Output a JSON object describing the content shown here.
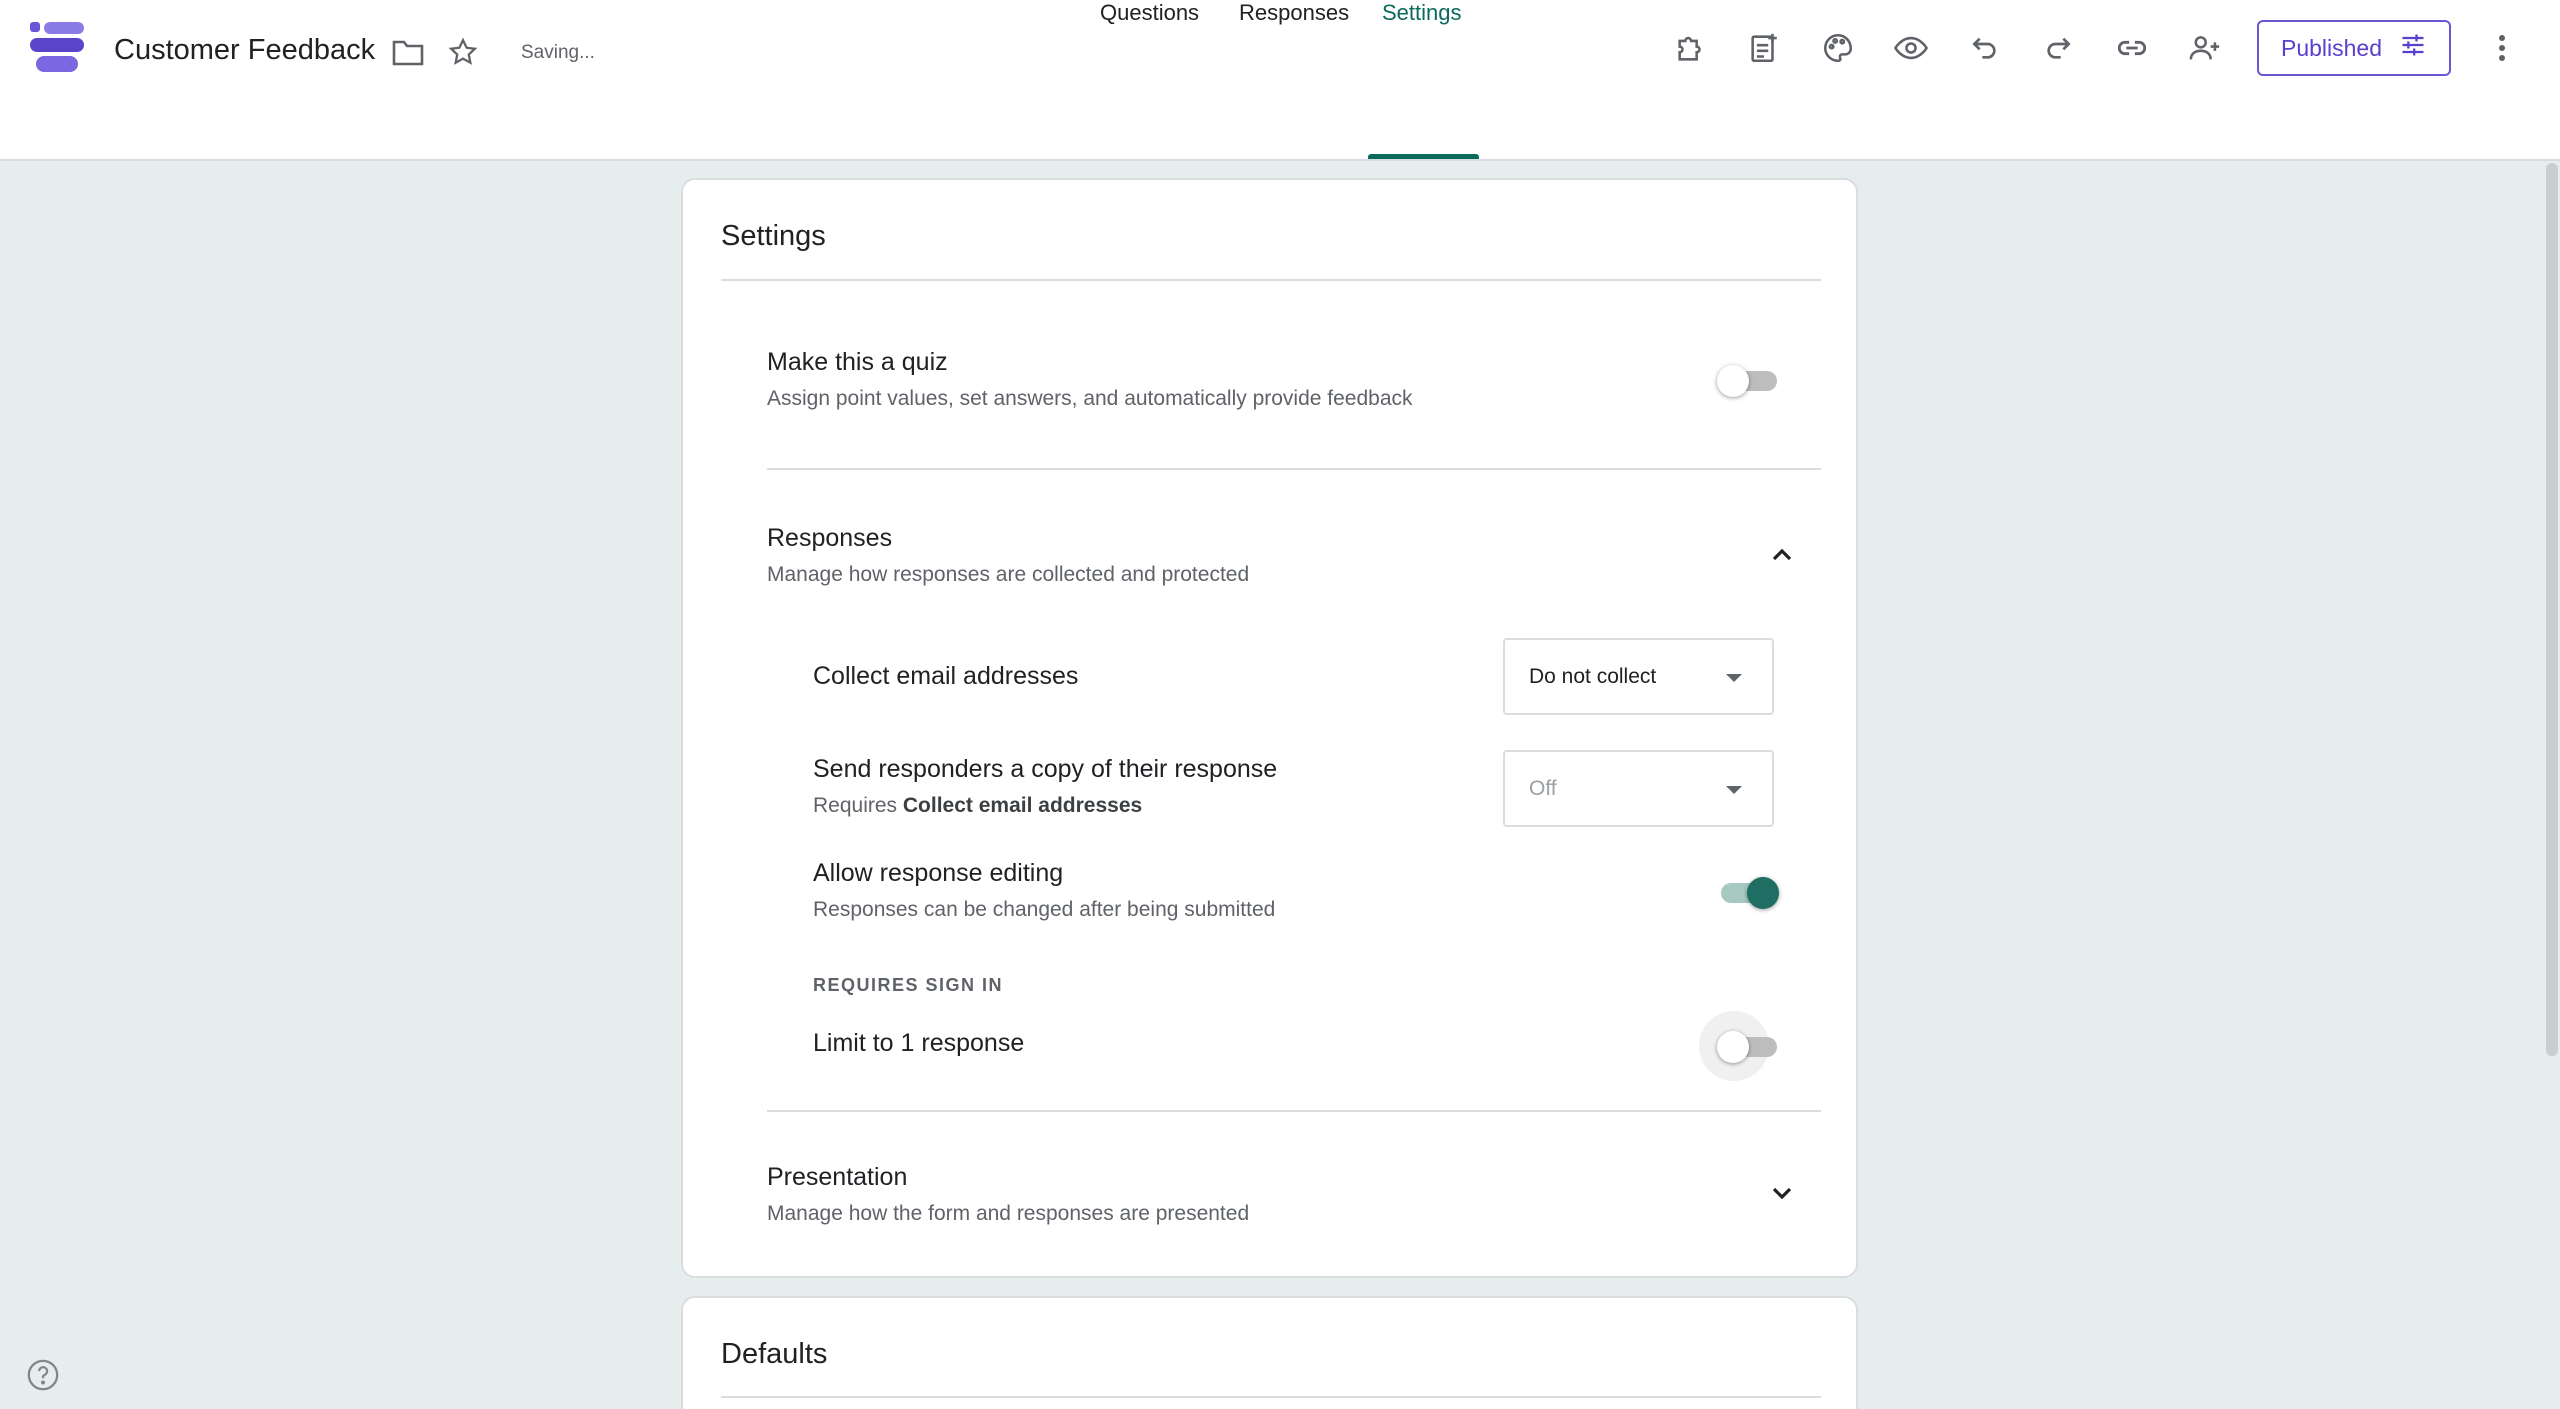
{
  "app": {
    "title": "Customer Feedback",
    "status": "Saving...",
    "published_label": "Published"
  },
  "tabs": [
    {
      "label": "Questions"
    },
    {
      "label": "Responses"
    },
    {
      "label": "Settings",
      "active": true
    }
  ],
  "toolbar_icons": [
    "addons-icon",
    "sheets-link-icon",
    "palette-icon",
    "preview-icon",
    "undo-icon",
    "redo-icon",
    "link-icon",
    "add-collaborator-icon"
  ],
  "settings": {
    "title": "Settings",
    "quiz": {
      "title": "Make this a quiz",
      "subtitle": "Assign point values, set answers, and automatically provide feedback",
      "enabled": false
    },
    "responses": {
      "title": "Responses",
      "subtitle": "Manage how responses are collected and protected",
      "expanded": true,
      "collect_email": {
        "label": "Collect email addresses",
        "value": "Do not collect"
      },
      "send_copy": {
        "label": "Send responders a copy of their response",
        "requires_prefix": "Requires",
        "requires_bold": "Collect email addresses",
        "value": "Off"
      },
      "allow_editing": {
        "label": "Allow response editing",
        "subtitle": "Responses can be changed after being submitted",
        "enabled": true
      },
      "requires_sign_in": "REQUIRES SIGN IN",
      "limit_one": {
        "label": "Limit to 1 response",
        "enabled": false
      }
    },
    "presentation": {
      "title": "Presentation",
      "subtitle": "Manage how the form and responses are presented",
      "expanded": false
    }
  },
  "defaults": {
    "title": "Defaults"
  },
  "colors": {
    "accent": "#0b6b5b",
    "published": "#5b3fce",
    "background": "#e6eeed"
  }
}
